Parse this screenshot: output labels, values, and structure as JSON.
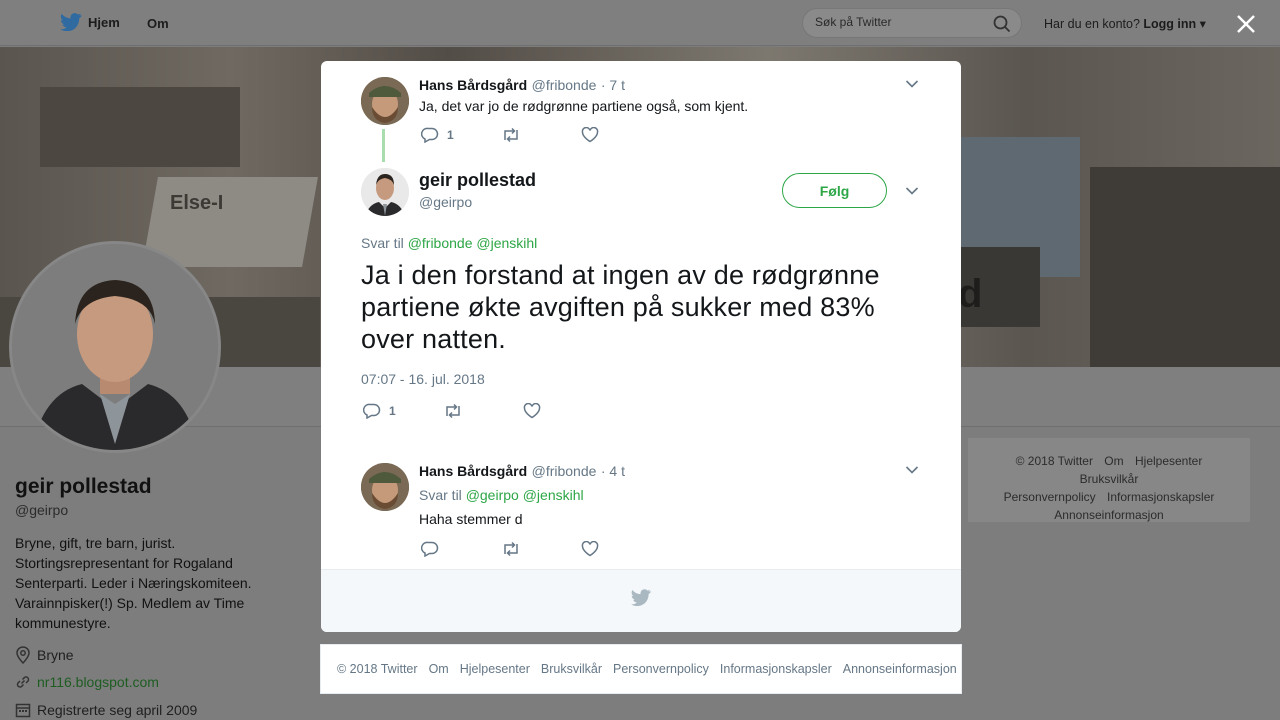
{
  "topnav": {
    "home_label": "Hjem",
    "about_label": "Om",
    "search_placeholder": "Søk på Twitter",
    "account_prompt": "Har du en konto?",
    "login_label": "Logg inn"
  },
  "colors": {
    "accent": "#2da646",
    "text_secondary": "#657786",
    "thread_line": "#a9dcaf"
  },
  "cover": {
    "banner_text": "Else-I",
    "banner_text_right": "d"
  },
  "profile": {
    "name": "geir pollestad",
    "handle": "@geirpo",
    "bio": "Bryne, gift, tre barn, jurist. Stortingsrepresentant for Rogaland Senterparti. Leder i Næringskomiteen. Varainnpisker(!) Sp. Medlem av Time kommunestyre.",
    "location": "Bryne",
    "website": "nr116.blogspot.com",
    "joined": "Registrerte seg april 2009"
  },
  "right_footer": {
    "links": [
      "© 2018 Twitter",
      "Om",
      "Hjelpesenter",
      "Bruksvilkår",
      "Personvernpolicy",
      "Informasjonskapsler",
      "Annonseinformasjon"
    ]
  },
  "tweet_parent": {
    "name": "Hans Bårdsgård",
    "handle": "@fribonde",
    "time": "· 7 t",
    "text": "Ja, det var jo de rødgrønne partiene også, som kjent.",
    "reply_count": "1"
  },
  "tweet_main": {
    "name": "geir pollestad",
    "handle": "@geirpo",
    "follow_label": "Følg",
    "reply_prefix": "Svar til",
    "reply_user1": "@fribonde",
    "reply_user2": "@jenskihl",
    "text": "Ja i den forstand at ingen av de rødgrønne partiene økte avgiften på sukker med 83% over natten.",
    "timestamp": "07:07 - 16. jul. 2018",
    "reply_count": "1"
  },
  "tweet_reply": {
    "name": "Hans Bårdsgård",
    "handle": "@fribonde",
    "time": "· 4 t",
    "reply_prefix": "Svar til",
    "reply_user1": "@geirpo",
    "reply_user2": "@jenskihl",
    "text": "Haha stemmer d"
  },
  "bottom_footer": {
    "links": [
      "© 2018 Twitter",
      "Om",
      "Hjelpesenter",
      "Bruksvilkår",
      "Personvernpolicy",
      "Informasjonskapsler",
      "Annonseinformasjon"
    ]
  }
}
